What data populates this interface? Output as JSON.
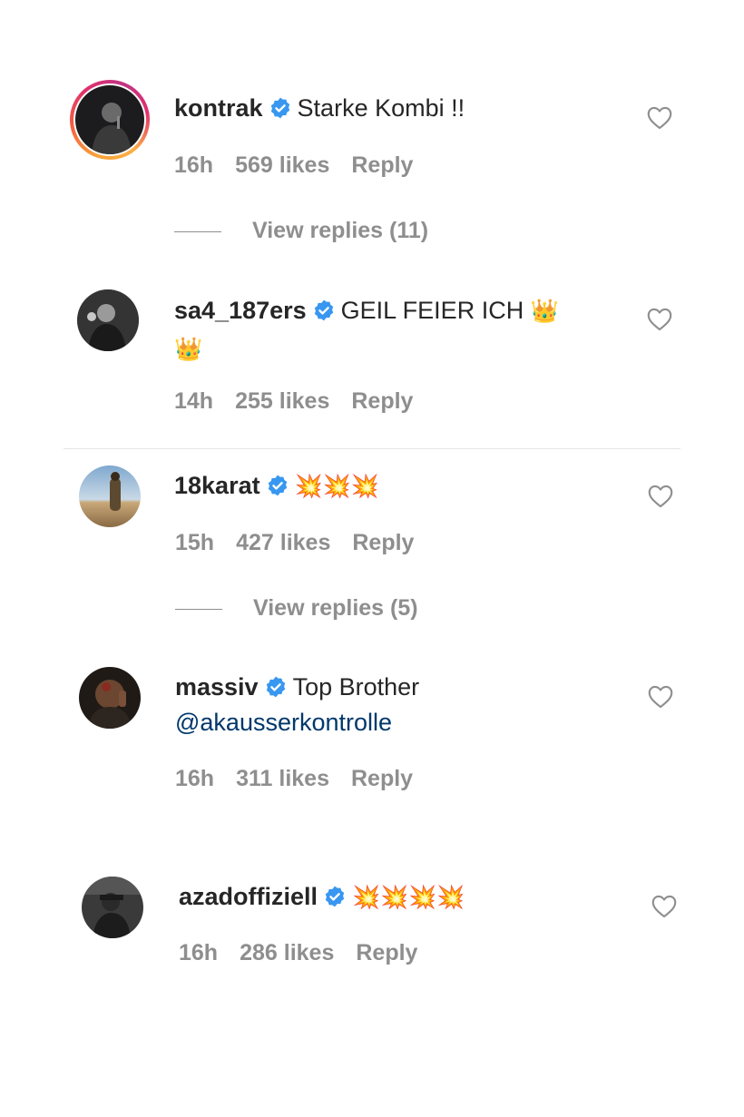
{
  "comments": [
    {
      "username": "kontrak",
      "text": "Starke Kombi !!",
      "time": "16h",
      "likes": "569 likes",
      "reply": "Reply",
      "view_replies": "View replies (11)",
      "has_story": true
    },
    {
      "username": "sa4_187ers",
      "text": "GEIL FEIER ICH",
      "emoji_line1": "👑",
      "emoji_line2": "👑",
      "time": "14h",
      "likes": "255 likes",
      "reply": "Reply"
    },
    {
      "username": "18karat",
      "emoji": "💥💥💥",
      "time": "15h",
      "likes": "427 likes",
      "reply": "Reply",
      "view_replies": "View replies (5)"
    },
    {
      "username": "massiv",
      "text": "Top Brother",
      "mention": "@akausserkontrolle",
      "time": "16h",
      "likes": "311 likes",
      "reply": "Reply"
    },
    {
      "username": "azadoffiziell",
      "emoji": "💥💥💥💥",
      "time": "16h",
      "likes": "286 likes",
      "reply": "Reply"
    }
  ],
  "icons": {
    "verified": "verified-badge-icon",
    "like": "heart-outline-icon"
  },
  "colors": {
    "text": "#262626",
    "secondary": "#8e8e8e",
    "verified": "#3897f0",
    "mention": "#00376b"
  }
}
